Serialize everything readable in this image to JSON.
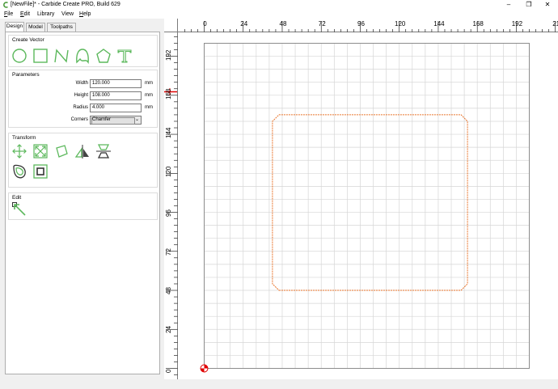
{
  "window": {
    "title": "[NewFile]* - Carbide Create PRO, Build 629",
    "minimize_icon": "minimize-icon",
    "maximize_icon": "restore-icon",
    "close_icon": "close-icon",
    "minimize_glyph": "–",
    "restore_glyph": "❐",
    "close_glyph": "✕"
  },
  "menu": [
    {
      "label": "File",
      "underline": "F",
      "rest": "ile"
    },
    {
      "label": "Edit",
      "underline": "E",
      "rest": "dit"
    },
    {
      "label": "Library",
      "underline": "",
      "rest": "Library"
    },
    {
      "label": "View",
      "underline": "",
      "rest": "View"
    },
    {
      "label": "Help",
      "underline": "H",
      "rest": "elp"
    }
  ],
  "tabs": [
    {
      "label": "Design",
      "active": true
    },
    {
      "label": "Model",
      "active": false
    },
    {
      "label": "Toolpaths",
      "active": false
    }
  ],
  "create_vector": {
    "title": "Create Vector",
    "tools": [
      "circle-icon",
      "rectangle-icon",
      "polyline-icon",
      "curve-icon",
      "polygon-icon",
      "text-icon"
    ]
  },
  "parameters": {
    "title": "Parameters",
    "width_label": "Width",
    "width_value": "120.000",
    "height_label": "Height",
    "height_value": "108.000",
    "radius_label": "Radius",
    "radius_value": "4.000",
    "unit": "mm",
    "corners_label": "Corners",
    "corners_value": "Chamfer"
  },
  "transform": {
    "title": "Transform",
    "tools": [
      "move-icon",
      "scale-icon",
      "rotate-icon",
      "mirror-icon",
      "align-icon",
      "offset-icon",
      "boolean-icon"
    ]
  },
  "edit": {
    "title": "Edit",
    "tools": [
      "node-edit-icon"
    ]
  },
  "ruler": {
    "top_labels": [
      "0",
      "24",
      "48",
      "72",
      "96",
      "120",
      "144",
      "168",
      "192",
      "21"
    ],
    "left_labels": [
      "192",
      "168",
      "144",
      "120",
      "96",
      "72",
      "48",
      "24",
      "0"
    ]
  },
  "colors": {
    "accent_green": "#5cb85c",
    "shape_orange": "#e8732a",
    "grid_minor": "#d6d6d6",
    "origin_red": "#e00000"
  },
  "shape": {
    "type": "chamfer-rectangle",
    "width_mm": 120,
    "height_mm": 108,
    "chamfer_mm": 4,
    "x_min_mm": 42,
    "y_min_mm": 48
  },
  "stock_mm": {
    "width": 200,
    "height": 200
  }
}
